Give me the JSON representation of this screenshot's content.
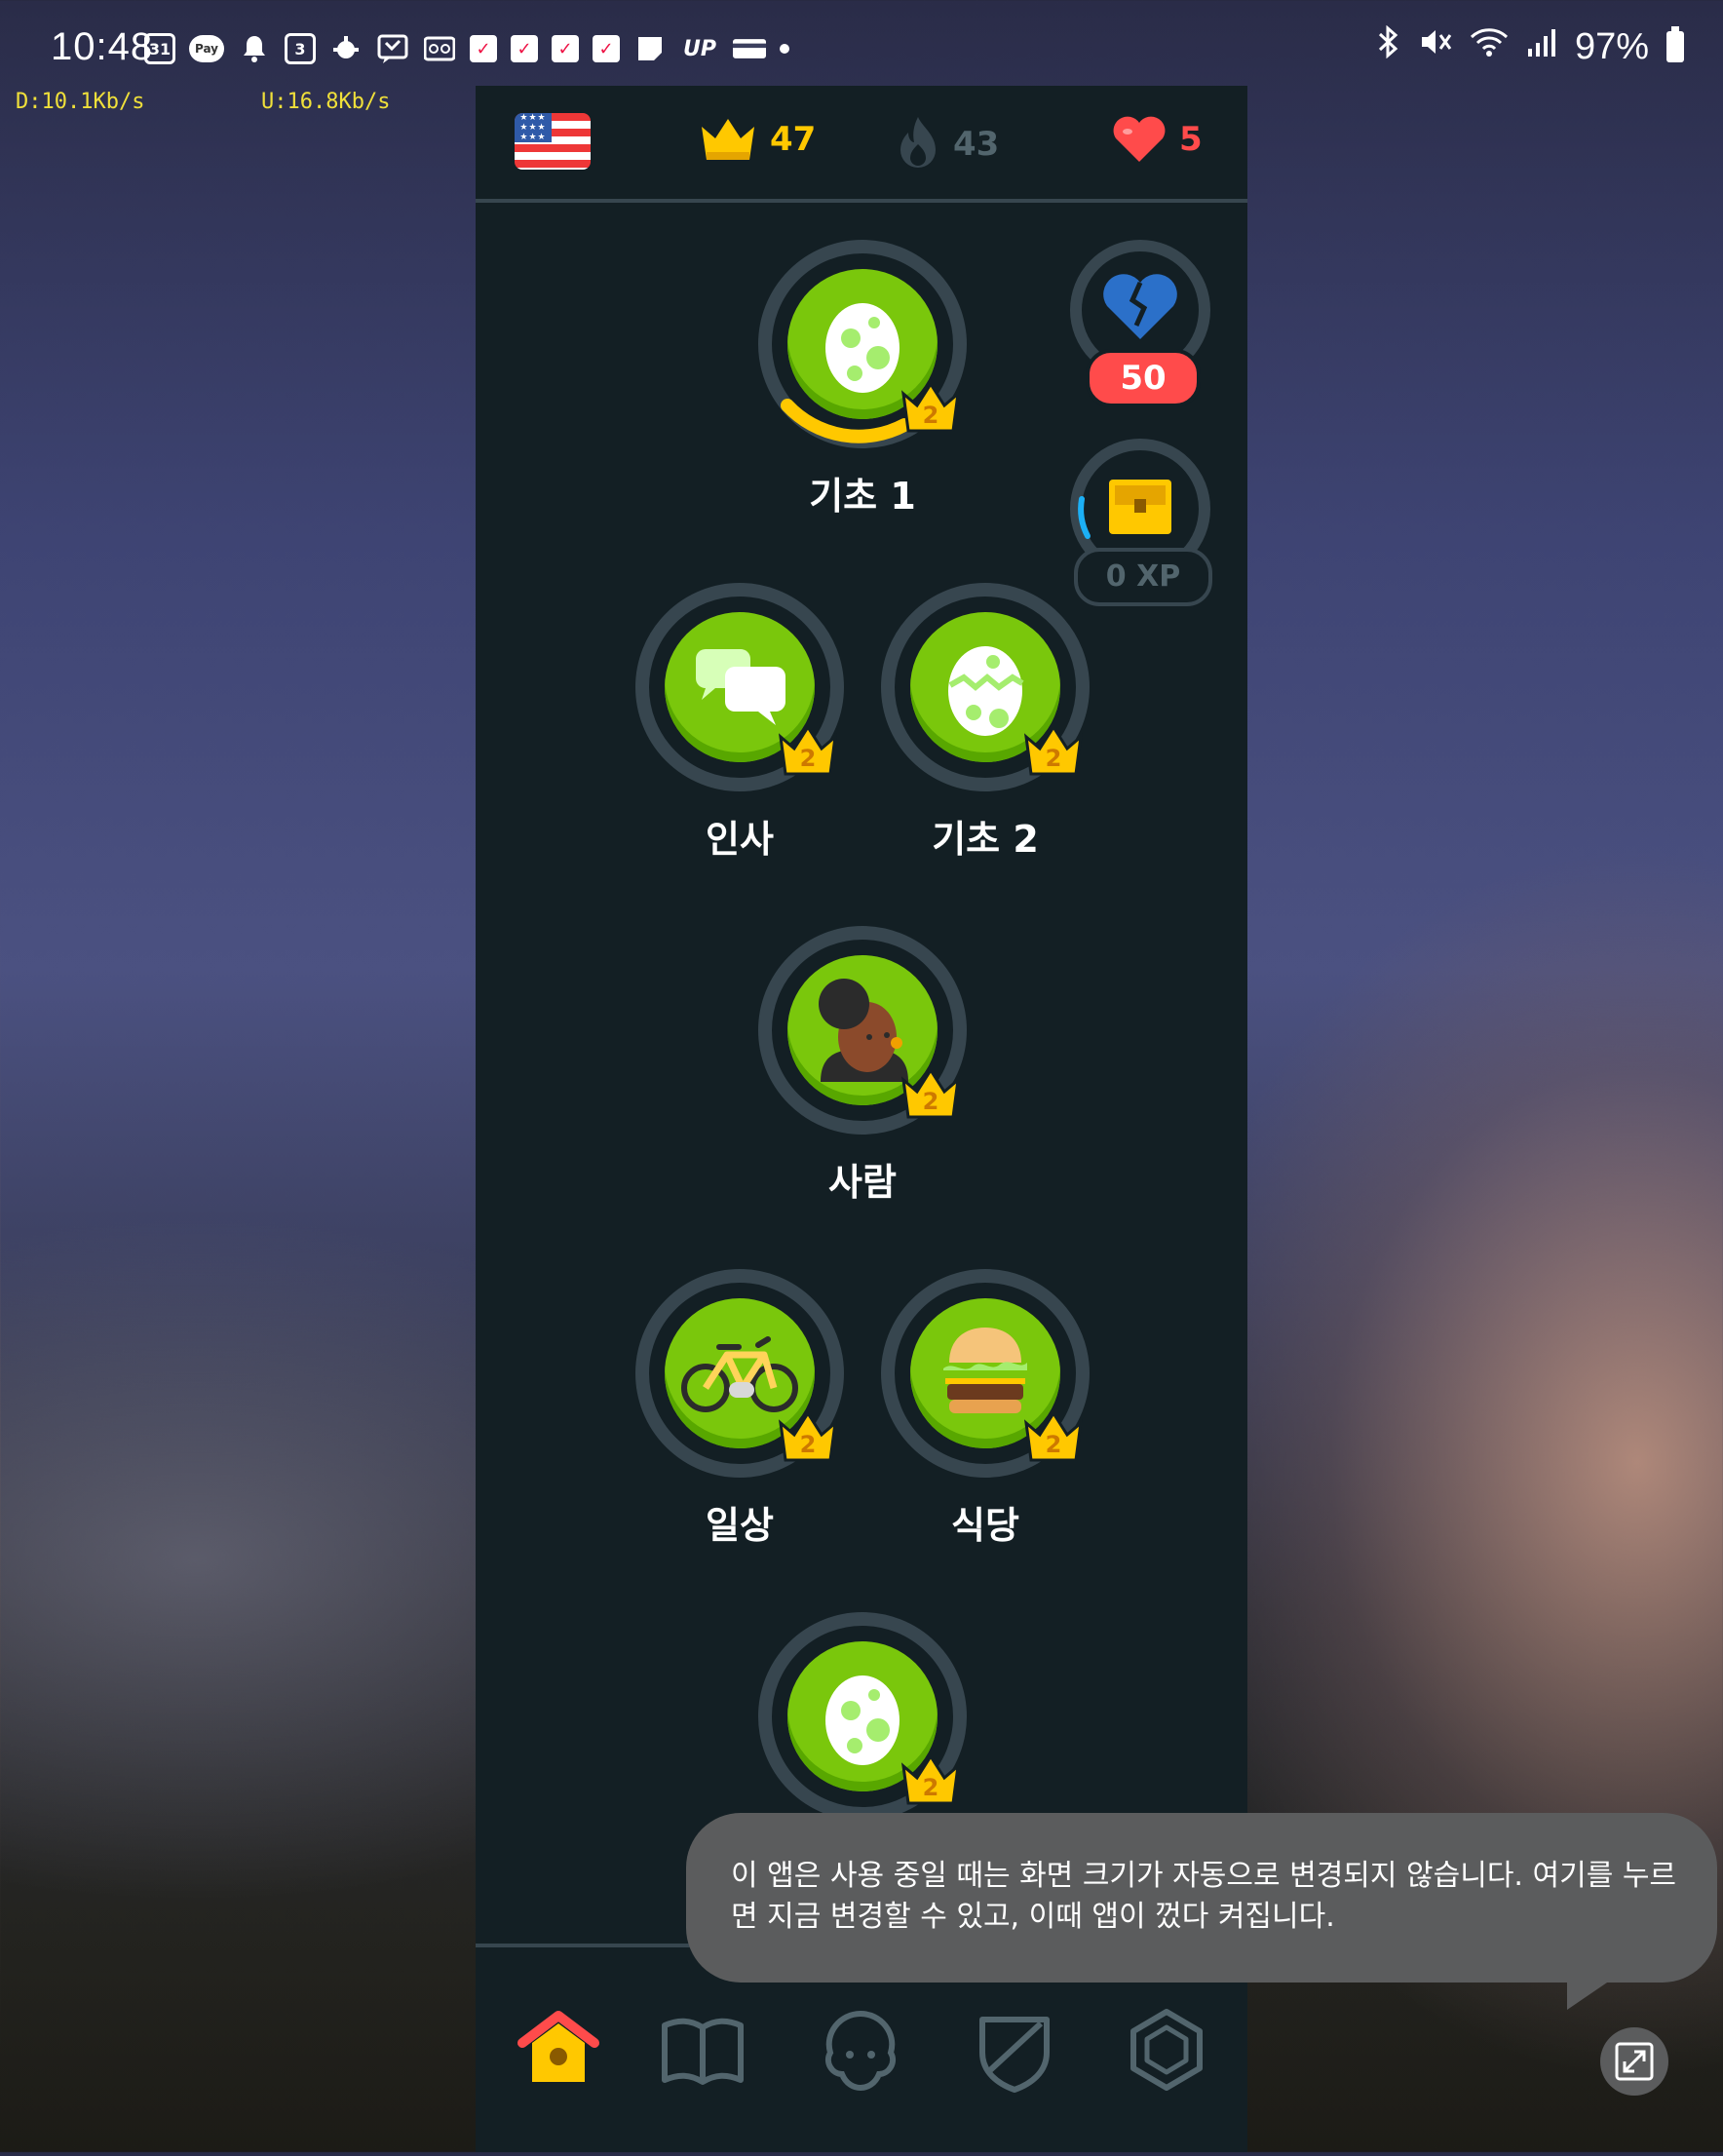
{
  "status_bar": {
    "time": "10:48",
    "calendar_day": "31",
    "pay_label": "Pay",
    "calendar_small": "3",
    "up_label": "UP",
    "battery": "97%",
    "download_speed": "D:10.1Kb/s",
    "upload_speed": "U:16.8Kb/s"
  },
  "topbar": {
    "crowns": "47",
    "streak": "43",
    "hearts": "5"
  },
  "side": {
    "health_badge": "50",
    "xp_label": "0 XP"
  },
  "skills": [
    {
      "label": "기초 1",
      "icon": "egg-icon",
      "crown": "2"
    },
    {
      "label": "인사",
      "icon": "chat-bubbles-icon",
      "crown": "2"
    },
    {
      "label": "기초 2",
      "icon": "cracked-egg-icon",
      "crown": "2"
    },
    {
      "label": "사람",
      "icon": "person-icon",
      "crown": "2"
    },
    {
      "label": "일상",
      "icon": "bicycle-icon",
      "crown": "2"
    },
    {
      "label": "식당",
      "icon": "burger-icon",
      "crown": "2"
    },
    {
      "label": "",
      "icon": "egg-icon",
      "crown": "2"
    }
  ],
  "toast": {
    "message": "이 앱은 사용 중일 때는 화면 크기가 자동으로 변경되지 않습니다. 여기를 누르면 지금 변경할 수 있고, 이때 앱이 껐다 켜집니다."
  },
  "colors": {
    "app_bg": "#131f24",
    "border": "#37464f",
    "skill_green": "#7ac70c",
    "crown_gold": "#ffc800",
    "heart_red": "#ff4b4b",
    "streak_gray": "#52656d",
    "home_orange": "#ff9600"
  }
}
